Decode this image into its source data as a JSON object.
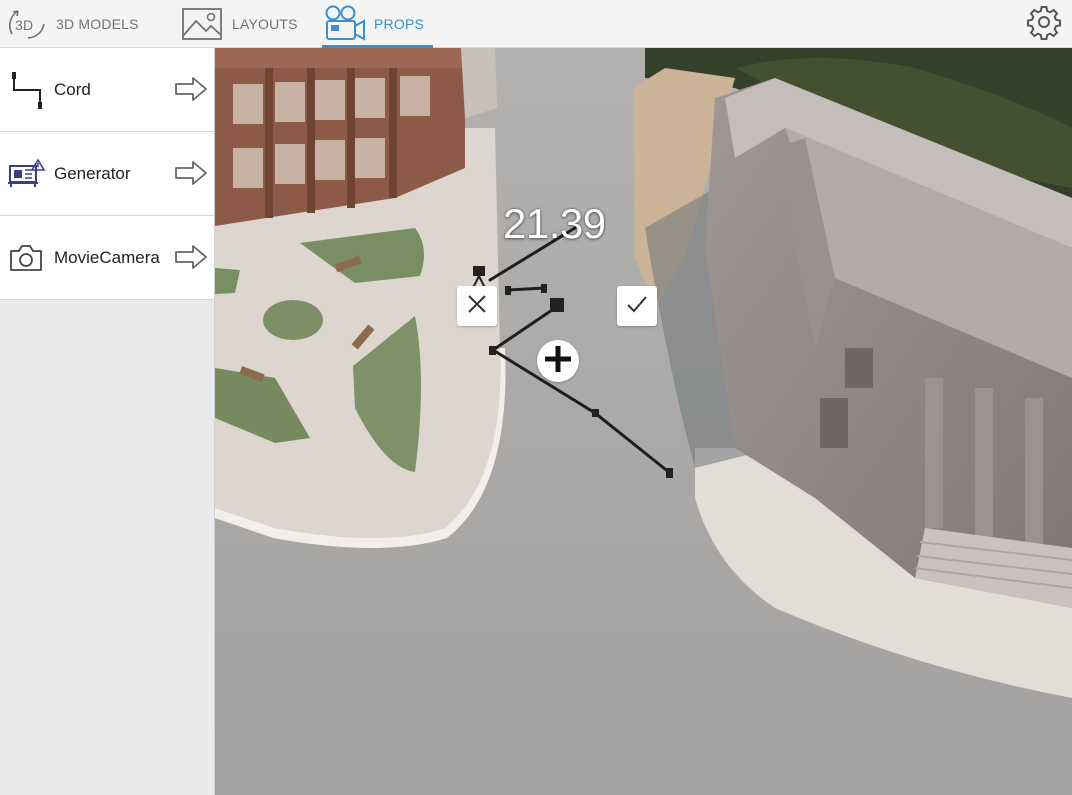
{
  "tabs": {
    "models": {
      "label": "3D MODELS",
      "icon": "3d-rotate-icon"
    },
    "layouts": {
      "label": "LAYOUTS",
      "icon": "image-icon"
    },
    "props": {
      "label": "PROPS",
      "icon": "movie-camera-icon",
      "active": true
    }
  },
  "settings": {
    "icon": "gear-icon"
  },
  "props_list": [
    {
      "label": "Cord",
      "icon": "cord-icon"
    },
    {
      "label": "Generator",
      "icon": "generator-icon"
    },
    {
      "label": "MovieCamera",
      "icon": "camera-icon"
    }
  ],
  "viewport": {
    "measurement": "21.39",
    "controls": {
      "cancel": "close-icon",
      "confirm": "check-icon",
      "add": "plus-icon"
    }
  },
  "colors": {
    "accent": "#3a8fcf",
    "tab_inactive": "#707277"
  }
}
